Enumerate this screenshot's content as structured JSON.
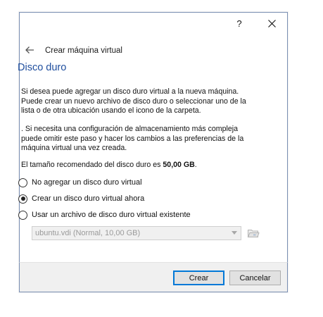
{
  "window": {
    "help_label": "?",
    "close_label": "✕"
  },
  "nav": {
    "back_icon": "arrow-left-icon",
    "title": "Crear máquina virtual"
  },
  "page": {
    "title": "Disco duro",
    "paragraph1": "Si desea puede agregar un disco duro virtual a la nueva máquina. Puede crear un nuevo archivo de disco duro o seleccionar uno de la lista o de otra ubicación usando el icono de la carpeta.",
    "paragraph2": ". Si necesita una configuración de almacenamiento más compleja puede omitir este paso y hacer los cambios a las preferencias de la máquina virtual una vez creada.",
    "recommended_prefix": "El tamaño recomendado del disco duro es ",
    "recommended_size": "50,00 GB",
    "recommended_suffix": "."
  },
  "options": [
    {
      "label": "No agregar un disco duro virtual",
      "checked": false
    },
    {
      "label": "Crear un disco duro virtual ahora",
      "checked": true
    },
    {
      "label": "Usar un archivo de disco duro virtual existente",
      "checked": false
    }
  ],
  "existing_file": {
    "selected": "ubuntu.vdi (Normal, 10,00 GB)",
    "enabled": false,
    "folder_icon": "folder-icon"
  },
  "buttons": {
    "create": "Crear",
    "cancel": "Cancelar"
  },
  "colors": {
    "title_blue": "#1f4e9e",
    "focus_blue": "#0078d7"
  }
}
